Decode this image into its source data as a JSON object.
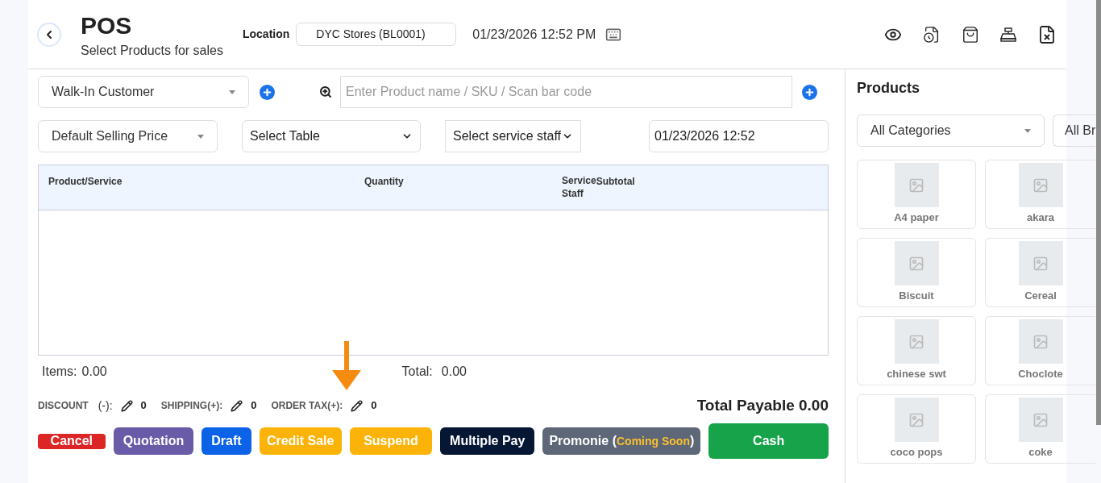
{
  "header": {
    "title": "POS",
    "subtitle": "Select Products for sales",
    "location_label": "Location",
    "location_value": "DYC Stores (BL0001)",
    "datetime": "01/23/2026 12:52 PM"
  },
  "filters": {
    "customer": "Walk-In Customer",
    "search_placeholder": "Enter Product name / SKU / Scan bar code",
    "price_group": "Default Selling Price",
    "table": "Select Table",
    "service_staff": "Select service staff",
    "transaction_date": "01/23/2026 12:52"
  },
  "table": {
    "columns": [
      "Product/Service",
      "Quantity",
      "Service Staff",
      "Subtotal"
    ]
  },
  "totals": {
    "items_label": "Items:",
    "items_value": "0.00",
    "total_label": "Total:",
    "total_value": "0.00",
    "payable": "Total Payable 0.00"
  },
  "adjustments": [
    {
      "label": "DISCOUNT",
      "sign": "(-):",
      "value": "0"
    },
    {
      "label": "SHIPPING(+):",
      "value": "0"
    },
    {
      "label": "ORDER TAX(+):",
      "value": "0"
    }
  ],
  "actions": [
    {
      "label": "Cancel"
    },
    {
      "label": "Quotation"
    },
    {
      "label": "Draft"
    },
    {
      "label": "Credit Sale"
    },
    {
      "label": "Suspend"
    },
    {
      "label": "Multiple Pay"
    },
    {
      "label": "Promonie (",
      "note": "Coming Soon",
      "label_end": ")"
    },
    {
      "label": "Cash"
    }
  ],
  "products": {
    "title": "Products",
    "category": "All Categories",
    "brand": "All Br",
    "items": [
      {
        "name": "A4 paper"
      },
      {
        "name": "akara"
      },
      {
        "name": "Biscuit"
      },
      {
        "name": "Cereal"
      },
      {
        "name": "chinese swt"
      },
      {
        "name": "Choclote"
      },
      {
        "name": "coco pops"
      },
      {
        "name": "coke"
      }
    ]
  }
}
